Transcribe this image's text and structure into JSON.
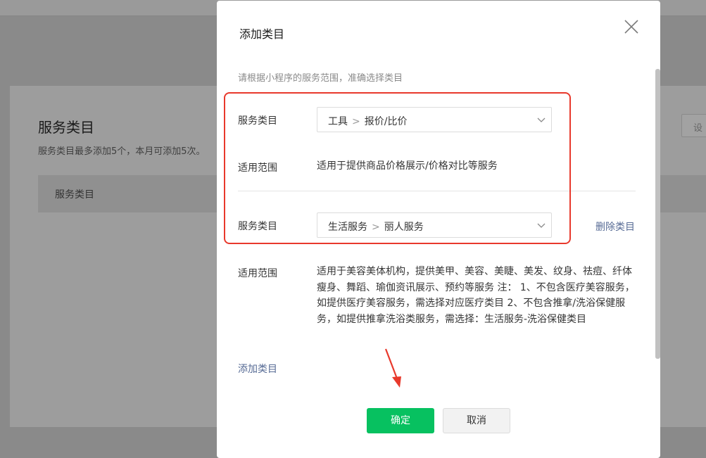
{
  "background": {
    "title": "服务类目",
    "subtitle": "服务类目最多添加5个，本月可添加5次。",
    "table_header": "服务类目",
    "settings_button": "设"
  },
  "dialog": {
    "title": "添加类目",
    "tip": "请根据小程序的服务范围，准确选择类目",
    "categories": [
      {
        "category_label": "服务类目",
        "primary": "工具",
        "secondary": "报价/比价",
        "scope_label": "适用范围",
        "scope_text": "适用于提供商品价格展示/价格对比等服务"
      },
      {
        "category_label": "服务类目",
        "primary": "生活服务",
        "secondary": "丽人服务",
        "delete_label": "删除类目",
        "scope_label": "适用范围",
        "scope_text": "适用于美容美体机构，提供美甲、美容、美睫、美发、纹身、祛痘、纤体瘦身、舞蹈、瑜伽资讯展示、预约等服务 注： 1、不包含医疗美容服务，如提供医疗美容服务，需选择对应医疗类目 2、不包含推拿/洗浴保健服务，如提供推拿洗浴类服务，需选择：生活服务-洗浴保健类目"
      }
    ],
    "add_category": "添加类目",
    "confirm": "确定",
    "cancel": "取消"
  },
  "colors": {
    "primary": "#07c160",
    "link": "#576b95",
    "annotation": "#e8392c"
  },
  "icons": {
    "close": "close-icon",
    "dropdown": "chevron-down-icon",
    "separator": "chevron-right-icon"
  }
}
